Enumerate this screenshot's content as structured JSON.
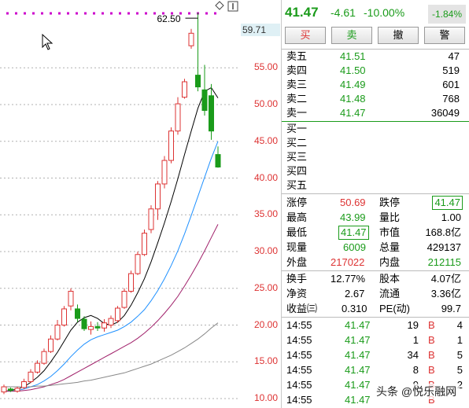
{
  "chart": {
    "peak_label": "62.50",
    "current_price_tag": "59.71",
    "axis_labels": [
      "55.00",
      "50.00",
      "45.00",
      "40.00",
      "35.00",
      "30.00",
      "25.00",
      "20.00",
      "15.00",
      "10.00"
    ],
    "colors": {
      "up": "#d33",
      "down": "#1a9b1a",
      "ma1": "#000000",
      "ma2": "#1e90ff",
      "ma3": "#a0206a",
      "ma4": "#888888",
      "dots": "#cc00cc"
    },
    "icons": [
      "diamond-icon",
      "window-toggle-icon"
    ]
  },
  "chart_data": {
    "type": "candlestick",
    "y_axis_range": [
      10,
      58
    ],
    "candles": [
      {
        "o": 10.9,
        "c": 11.6,
        "h": 11.9,
        "l": 10.6
      },
      {
        "o": 11.3,
        "c": 11.1,
        "h": 11.5,
        "l": 10.9
      },
      {
        "o": 11.0,
        "c": 11.4,
        "h": 11.6,
        "l": 10.8
      },
      {
        "o": 11.5,
        "c": 12.3,
        "h": 12.7,
        "l": 11.3
      },
      {
        "o": 12.3,
        "c": 13.6,
        "h": 14.0,
        "l": 12.1
      },
      {
        "o": 13.6,
        "c": 14.8,
        "h": 15.2,
        "l": 13.4
      },
      {
        "o": 14.8,
        "c": 16.4,
        "h": 16.8,
        "l": 14.6
      },
      {
        "o": 16.4,
        "c": 18.1,
        "h": 18.6,
        "l": 16.2
      },
      {
        "o": 18.1,
        "c": 20.0,
        "h": 20.7,
        "l": 17.9
      },
      {
        "o": 20.0,
        "c": 22.2,
        "h": 22.6,
        "l": 19.8
      },
      {
        "o": 22.6,
        "c": 24.6,
        "h": 25.0,
        "l": 22.0
      },
      {
        "o": 22.2,
        "c": 20.9,
        "h": 22.8,
        "l": 20.4
      },
      {
        "o": 20.8,
        "c": 19.5,
        "h": 21.2,
        "l": 19.2
      },
      {
        "o": 19.4,
        "c": 19.8,
        "h": 20.5,
        "l": 18.7
      },
      {
        "o": 19.8,
        "c": 19.6,
        "h": 20.4,
        "l": 19.2
      },
      {
        "o": 19.6,
        "c": 20.3,
        "h": 20.8,
        "l": 19.1
      },
      {
        "o": 20.0,
        "c": 20.9,
        "h": 21.3,
        "l": 19.6
      },
      {
        "o": 20.6,
        "c": 22.3,
        "h": 22.6,
        "l": 20.3
      },
      {
        "o": 22.4,
        "c": 24.6,
        "h": 25.0,
        "l": 22.2
      },
      {
        "o": 24.6,
        "c": 27.0,
        "h": 27.4,
        "l": 24.4
      },
      {
        "o": 27.0,
        "c": 29.6,
        "h": 30.0,
        "l": 26.8
      },
      {
        "o": 29.6,
        "c": 32.5,
        "h": 33.0,
        "l": 29.4
      },
      {
        "o": 33.0,
        "c": 35.8,
        "h": 36.3,
        "l": 32.5
      },
      {
        "o": 35.8,
        "c": 39.2,
        "h": 39.6,
        "l": 34.3
      },
      {
        "o": 39.2,
        "c": 42.4,
        "h": 43.0,
        "l": 38.6
      },
      {
        "o": 42.4,
        "c": 46.4,
        "h": 46.9,
        "l": 42.0
      },
      {
        "o": 46.4,
        "c": 50.1,
        "h": 51.0,
        "l": 45.9
      },
      {
        "o": 51.0,
        "c": 53.1,
        "h": 53.5,
        "l": 50.8
      },
      {
        "o": 58.0,
        "c": 59.7,
        "h": 60.3,
        "l": 57.6
      },
      {
        "o": 54.0,
        "c": 52.4,
        "h": 62.5,
        "l": 51.8
      },
      {
        "o": 52.0,
        "c": 49.2,
        "h": 55.4,
        "l": 48.5
      },
      {
        "o": 51.2,
        "c": 46.4,
        "h": 52.8,
        "l": 45.2
      },
      {
        "o": 43.2,
        "c": 41.5,
        "h": 44.3,
        "l": 41.4
      }
    ],
    "ma_lines": [
      {
        "name": "MA5",
        "values": [
          11.0,
          11.1,
          11.3,
          11.6,
          12.2,
          12.9,
          13.8,
          15.0,
          16.3,
          17.8,
          19.3,
          20.4,
          21.0,
          21.3,
          20.9,
          20.2,
          20.0,
          20.4,
          21.3,
          22.7,
          24.4,
          26.3,
          28.6,
          31.2,
          33.9,
          36.8,
          39.9,
          43.2,
          46.4,
          49.5,
          51.8,
          52.3,
          50.9
        ]
      },
      {
        "name": "MA10",
        "values": [
          11.0,
          11.0,
          11.1,
          11.3,
          11.6,
          11.9,
          12.4,
          13.0,
          13.8,
          14.7,
          15.7,
          16.6,
          17.4,
          18.0,
          18.4,
          18.7,
          19.0,
          19.3,
          19.8,
          20.4,
          21.2,
          22.1,
          23.3,
          24.7,
          26.3,
          28.1,
          30.1,
          32.4,
          34.9,
          37.5,
          40.1,
          42.7,
          45.0
        ]
      },
      {
        "name": "MA20",
        "values": [
          11.0,
          11.0,
          11.0,
          11.1,
          11.2,
          11.4,
          11.6,
          11.9,
          12.2,
          12.6,
          13.1,
          13.6,
          14.1,
          14.6,
          15.1,
          15.6,
          16.1,
          16.6,
          17.1,
          17.6,
          18.2,
          18.9,
          19.7,
          20.6,
          21.6,
          22.7,
          23.9,
          25.3,
          26.8,
          28.4,
          30.1,
          31.9,
          33.7
        ]
      },
      {
        "name": "MA60",
        "values": [
          11.6,
          11.6,
          11.6,
          11.6,
          11.6,
          11.7,
          11.7,
          11.8,
          11.9,
          12.0,
          12.1,
          12.2,
          12.4,
          12.5,
          12.7,
          12.9,
          13.1,
          13.3,
          13.5,
          13.8,
          14.1,
          14.4,
          14.7,
          15.1,
          15.5,
          15.9,
          16.4,
          16.9,
          17.5,
          18.1,
          18.8,
          19.6,
          20.3
        ]
      }
    ]
  },
  "panel": {
    "header": {
      "price": "41.47",
      "change": "-4.61",
      "pct": "-10.00%",
      "tag": "-1.84%"
    },
    "buttons": [
      "买",
      "卖",
      "撤",
      "警"
    ],
    "sell_orders": [
      {
        "label": "卖五",
        "price": "41.51",
        "vol": "47"
      },
      {
        "label": "卖四",
        "price": "41.50",
        "vol": "519"
      },
      {
        "label": "卖三",
        "price": "41.49",
        "vol": "601"
      },
      {
        "label": "卖二",
        "price": "41.48",
        "vol": "768"
      },
      {
        "label": "卖一",
        "price": "41.47",
        "vol": "36049"
      }
    ],
    "buy_orders": [
      {
        "label": "买一"
      },
      {
        "label": "买二"
      },
      {
        "label": "买三"
      },
      {
        "label": "买四"
      },
      {
        "label": "买五"
      }
    ],
    "stats_a": {
      "limit_up_label": "涨停",
      "limit_up": "50.69",
      "limit_down_label": "跌停",
      "limit_down": "41.47",
      "high_label": "最高",
      "high": "43.99",
      "vol_ratio_label": "量比",
      "vol_ratio": "1.00",
      "low_label": "最低",
      "low": "41.47",
      "mktcap_label": "市值",
      "mktcap": "168.8亿",
      "cur_vol_label": "现量",
      "cur_vol": "6009",
      "total_vol_label": "总量",
      "total_vol": "429137",
      "outer_label": "外盘",
      "outer": "217022",
      "inner_label": "内盘",
      "inner": "212115"
    },
    "stats_b": {
      "turnover_label": "换手",
      "turnover": "12.77%",
      "equity_label": "股本",
      "equity": "4.07亿",
      "nav_label": "净资",
      "nav": "2.67",
      "float_label": "流通",
      "float": "3.36亿",
      "eps_label": "收益㈢",
      "eps": "0.310",
      "pe_label": "PE(动)",
      "pe": "99.7"
    },
    "ticks": [
      {
        "time": "14:55",
        "price": "41.47",
        "vol": "19",
        "bs": "B",
        "n": "4"
      },
      {
        "time": "14:55",
        "price": "41.47",
        "vol": "1",
        "bs": "B",
        "n": "1"
      },
      {
        "time": "14:55",
        "price": "41.47",
        "vol": "34",
        "bs": "B",
        "n": "5"
      },
      {
        "time": "14:55",
        "price": "41.47",
        "vol": "8",
        "bs": "B",
        "n": "5"
      },
      {
        "time": "14:55",
        "price": "41.47",
        "vol": "9",
        "bs": "B",
        "n": "2"
      },
      {
        "time": "14:55",
        "price": "41.47",
        "vol": "",
        "bs": "B",
        "n": ""
      }
    ]
  },
  "watermark": "头条 @悦乐融网"
}
